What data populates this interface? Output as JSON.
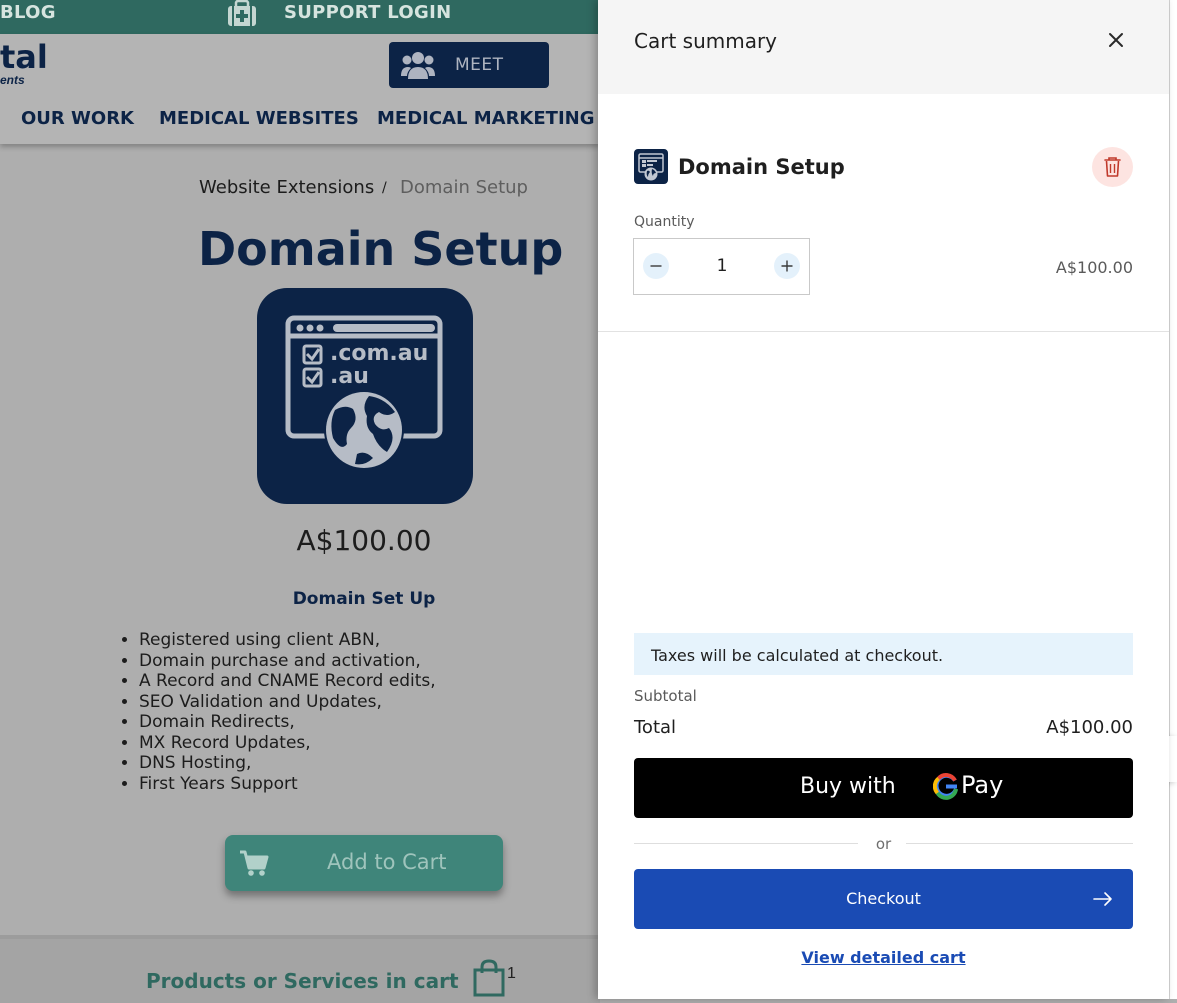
{
  "background": {
    "topbar": {
      "blog": "BLOG",
      "support_login": "SUPPORT LOGIN"
    },
    "logo": {
      "line1": "tal",
      "line2": "ents"
    },
    "meet_button": "MEET",
    "nav": [
      "OUR WORK",
      "MEDICAL WEBSITES",
      "MEDICAL MARKETING"
    ],
    "breadcrumb": {
      "parent": "Website Extensions",
      "separator": "/",
      "current": "Domain Setup"
    },
    "product": {
      "title": "Domain Setup",
      "image_text": {
        "line1": ".com.au",
        "line2": ".au"
      },
      "price": "A$100.00",
      "subheading": "Domain Set Up",
      "features": [
        "Registered using client ABN,",
        "Domain purchase and activation,",
        "A Record and CNAME Record edits,",
        "SEO Validation and Updates,",
        "Domain Redirects,",
        "MX Record Updates,",
        "DNS Hosting,",
        "First Years Support"
      ],
      "add_to_cart": "Add to Cart"
    },
    "cart_bar": {
      "label": "Products or Services in cart",
      "count": "1"
    }
  },
  "cart": {
    "title": "Cart summary",
    "item": {
      "name": "Domain Setup",
      "quantity_label": "Quantity",
      "quantity": "1",
      "price": "A$100.00"
    },
    "tax_note": "Taxes will be calculated at checkout.",
    "subtotal_label": "Subtotal",
    "total_label": "Total",
    "total_value": "A$100.00",
    "gpay": {
      "prefix": "Buy with",
      "brand": "Pay"
    },
    "or": "or",
    "checkout": "Checkout",
    "view_cart": "View detailed cart"
  },
  "colors": {
    "navy": "#0c2346",
    "teal": "#2f6960",
    "checkout_blue": "#1a4bb4",
    "delete_red": "#c0392b"
  }
}
